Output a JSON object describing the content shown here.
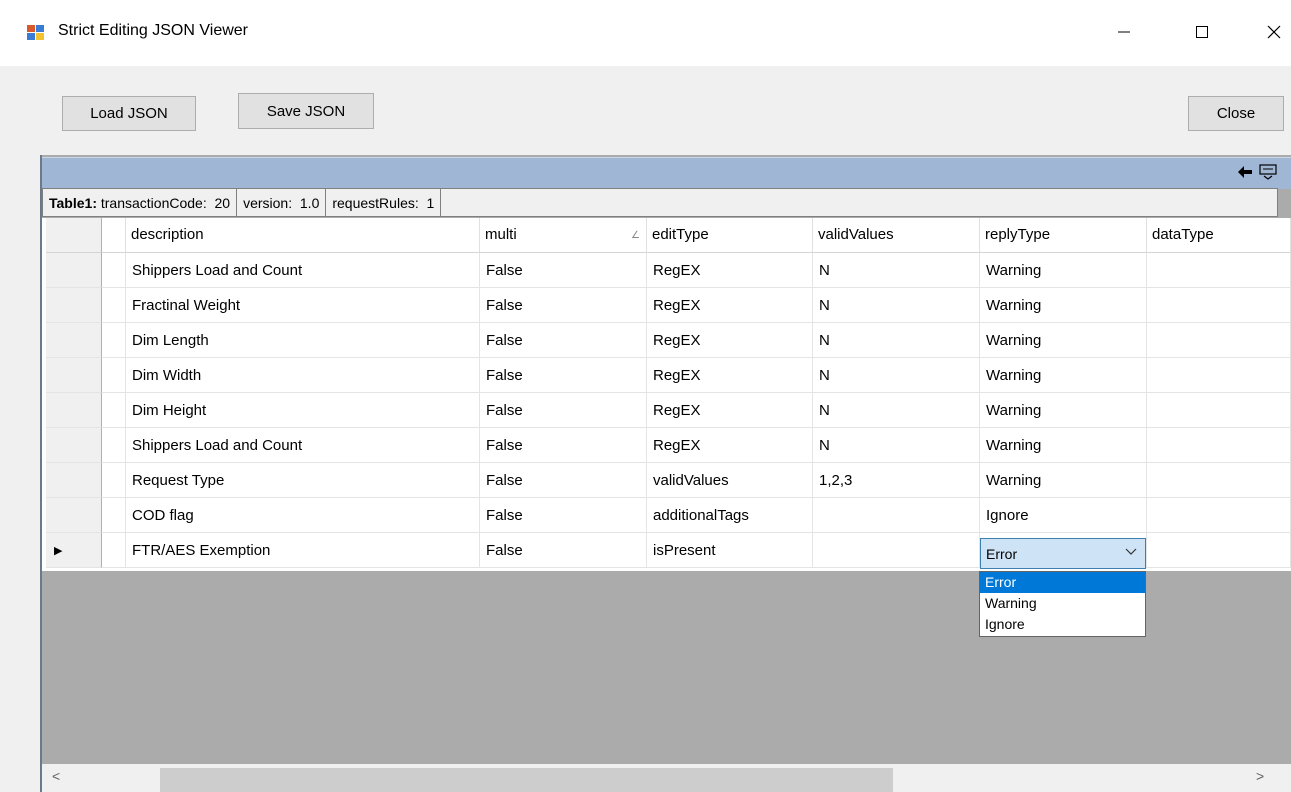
{
  "window": {
    "title": "Strict Editing JSON Viewer",
    "minimize_glyph": "—",
    "maximize_glyph": "☐",
    "close_glyph": "✕"
  },
  "toolbar": {
    "load_label": "Load JSON",
    "save_label": "Save JSON",
    "close_label": "Close"
  },
  "grid": {
    "caption_icons": [
      "back-arrow-icon",
      "relations-icon"
    ],
    "parent": {
      "table_label": "Table1:",
      "fields": [
        {
          "name": "transactionCode:",
          "value": "20"
        },
        {
          "name": "version:",
          "value": "1.0"
        },
        {
          "name": "requestRules:",
          "value": "1"
        }
      ]
    },
    "columns": [
      "description",
      "multi",
      "editType",
      "validValues",
      "replyType",
      "dataType"
    ],
    "rows": [
      {
        "description": "Shippers Load and Count",
        "multi": "False",
        "editType": "RegEX",
        "validValues": "N",
        "replyType": "Warning",
        "dataType": ""
      },
      {
        "description": "Fractinal Weight",
        "multi": "False",
        "editType": "RegEX",
        "validValues": "N",
        "replyType": "Warning",
        "dataType": ""
      },
      {
        "description": "Dim Length",
        "multi": "False",
        "editType": "RegEX",
        "validValues": "N",
        "replyType": "Warning",
        "dataType": ""
      },
      {
        "description": "Dim Width",
        "multi": "False",
        "editType": "RegEX",
        "validValues": "N",
        "replyType": "Warning",
        "dataType": ""
      },
      {
        "description": "Dim Height",
        "multi": "False",
        "editType": "RegEX",
        "validValues": "N",
        "replyType": "Warning",
        "dataType": ""
      },
      {
        "description": "Shippers Load and Count",
        "multi": "False",
        "editType": "RegEX",
        "validValues": "N",
        "replyType": "Warning",
        "dataType": ""
      },
      {
        "description": "Request Type",
        "multi": "False",
        "editType": "validValues",
        "validValues": "1,2,3",
        "replyType": "Warning",
        "dataType": ""
      },
      {
        "description": "COD flag",
        "multi": "False",
        "editType": "additionalTags",
        "validValues": "",
        "replyType": "Ignore",
        "dataType": ""
      },
      {
        "description": "FTR/AES Exemption",
        "multi": "False",
        "editType": "isPresent",
        "validValues": "",
        "replyType": "Error",
        "dataType": ""
      }
    ],
    "current_row_glyph": "▶",
    "editing": {
      "value": "Error",
      "options": [
        "Error",
        "Warning",
        "Ignore"
      ],
      "selected": "Error"
    }
  },
  "scrollbar": {
    "left_glyph": "<",
    "right_glyph": ">"
  },
  "colors": {
    "caption_bar": "#9fb7d4",
    "selection": "#0078d7",
    "combo_bg": "#cfe3f7"
  }
}
